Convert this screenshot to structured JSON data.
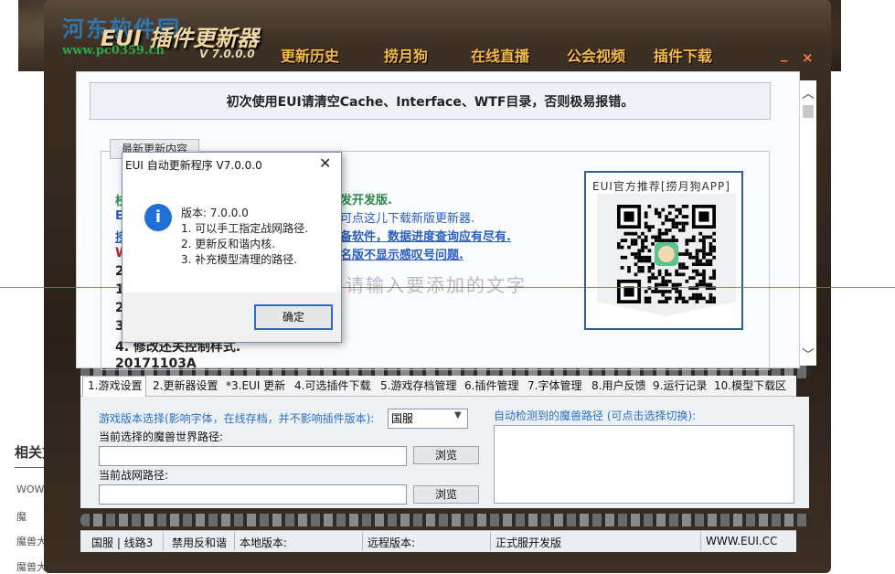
{
  "background_page": {
    "side_title": "相关文",
    "side_items": [
      "WOW魔",
      "魔",
      "魔兽大帥",
      "魔兽大帥"
    ]
  },
  "watermark": {
    "site_name": "河东软件园",
    "site_url": "www.pc0359.cn"
  },
  "app": {
    "title": "EUI 插件更新器",
    "version": "V 7.0.0.0",
    "nav": [
      "更新历史",
      "捞月狗",
      "在线直播",
      "公会视频",
      "插件下载"
    ],
    "minimize_glyph": "_",
    "close_glyph": "×"
  },
  "notice": "初次使用EUI请清空Cache、Interface、WTF目录，否则极易报错。",
  "update_group": {
    "tab_label": "最新更新内容",
    "lines": [
      {
        "text": "发开发版.",
        "style": "green"
      },
      {
        "text": "可点这儿下载新版更新器.",
        "style": "blue"
      },
      {
        "text": "备软件，数据进度查询应有尽有.",
        "style": "blue"
      },
      {
        "text": "名版不显示感叹号问题.",
        "style": "blue"
      },
      {
        "text": "2",
        "style": "dark"
      },
      {
        "text": "1",
        "style": "dark"
      },
      {
        "text": "2",
        "style": "dark"
      },
      {
        "text": "3",
        "style": "dark"
      },
      {
        "text": "4. 修改还关控制样式.",
        "style": "dark"
      },
      {
        "text": "20171103A",
        "style": "dark"
      }
    ],
    "left_fragments": [
      "枝",
      "E",
      "捞",
      "W"
    ],
    "overlay_placeholder": "请输入要添加的文字"
  },
  "qr": {
    "label": "EUI官方推荐[捞月狗APP]"
  },
  "dialog": {
    "title": "EUI 自动更新程序 V7.0.0.0",
    "close_glyph": "✕",
    "icon_glyph": "i",
    "lines": [
      "版本: 7.0.0.0",
      "1. 可以手工指定战网路径.",
      "2. 更新反和谐内核.",
      "3. 补充模型清理的路径."
    ],
    "ok_label": "确定"
  },
  "tabs": [
    "1.游戏设置",
    "2.更新器设置",
    "*3.EUI 更新",
    "4.可选插件下载",
    "5.游戏存档管理",
    "6.插件管理",
    "7.字体管理",
    "8.用户反馈",
    "9.运行记录",
    "10.模型下载区"
  ],
  "settings": {
    "version_select_label": "游戏版本选择(影响字体，在线存档，并不影响插件版本):",
    "version_selected": "国服",
    "wow_path_label": "当前选择的魔兽世界路径:",
    "wow_path_value": "",
    "bnet_path_label": "当前战网路径:",
    "bnet_path_value": "",
    "browse_label": "浏览",
    "detected_label": "自动检测到的魔兽路径 (可点击选择切换):"
  },
  "status": {
    "server": "国服 | 线路3",
    "anti_harmony": "禁用反和谐",
    "local_version": "本地版本:",
    "remote_version": "远程版本:",
    "channel": "正式服开发版",
    "site": "WWW.EUI.CC"
  },
  "scroll": {
    "up_glyph": "︿",
    "down_glyph": "﹀"
  },
  "colors": {
    "accent_blue": "#2a70c8",
    "nav_orange": "#f5b84a",
    "frame_brown": "#3c2f24",
    "link_green": "#2a8a4a"
  }
}
